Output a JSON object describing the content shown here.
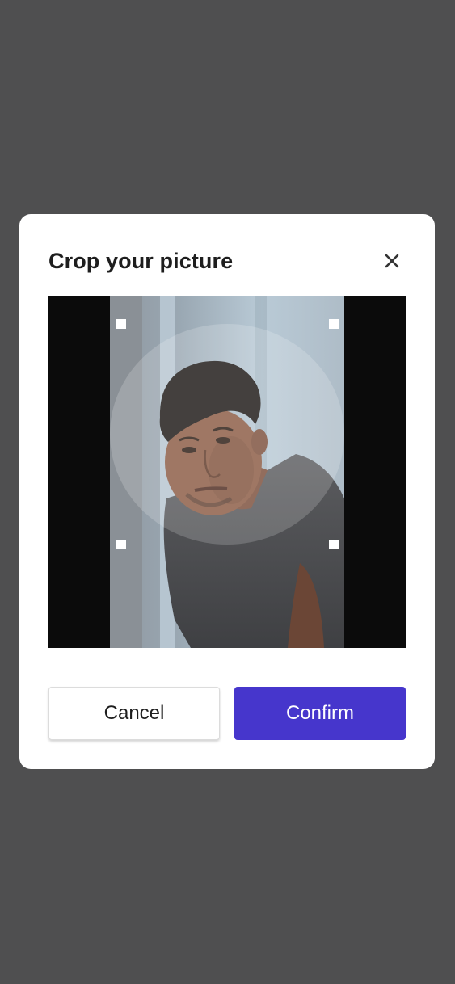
{
  "dialog": {
    "title": "Crop your picture",
    "close_icon": "close-icon",
    "cancel_label": "Cancel",
    "confirm_label": "Confirm"
  },
  "colors": {
    "backdrop": "#4f4f50",
    "dialog_background": "#ffffff",
    "confirm_button": "#4636cc",
    "crop_background": "#0b0b0b",
    "handle": "#ffffff"
  },
  "crop": {
    "shape": "circle",
    "handles": [
      "top-left",
      "top-right",
      "bottom-left",
      "bottom-right"
    ]
  }
}
